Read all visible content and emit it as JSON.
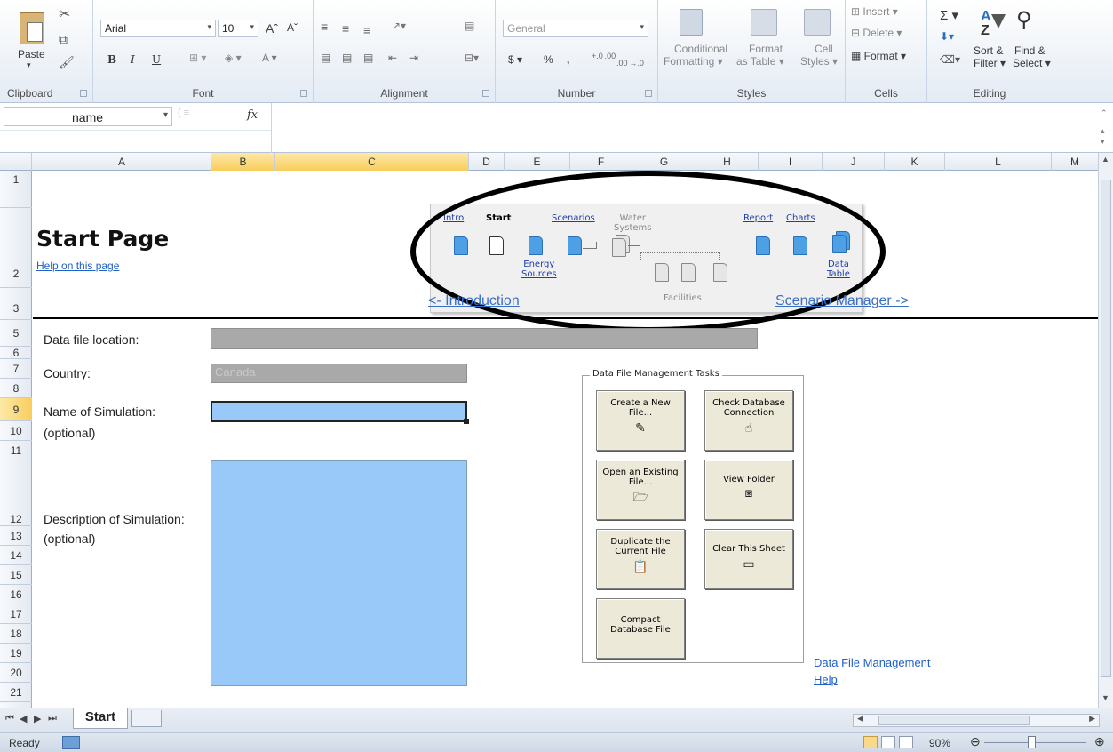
{
  "ribbon": {
    "clipboard": {
      "paste": "Paste",
      "label": "Clipboard"
    },
    "font": {
      "name": "Arial",
      "size": "10",
      "bold": "B",
      "italic": "I",
      "underline": "U",
      "grow": "Aˆ",
      "shrink": "Aˇ",
      "label": "Font"
    },
    "alignment": {
      "label": "Alignment"
    },
    "number": {
      "format": "General",
      "currency": "$",
      "percent": "%",
      "comma": ",",
      "inc_dec": "+.0 .00",
      "dec_dec": ".00 →.0",
      "label": "Number"
    },
    "styles": {
      "conditional": "Conditional",
      "conditional2": "Formatting",
      "format_table": "Format",
      "format_table2": "as Table",
      "cell_styles": "Cell",
      "cell_styles2": "Styles",
      "label": "Styles"
    },
    "cells": {
      "insert": "Insert",
      "delete": "Delete",
      "format": "Format",
      "label": "Cells"
    },
    "editing": {
      "sigma": "Σ",
      "sort": "Sort &",
      "sort2": "Filter",
      "find": "Find &",
      "find2": "Select",
      "label": "Editing"
    }
  },
  "formula_bar": {
    "name_box": "name",
    "fx": "fx",
    "value": ""
  },
  "columns": [
    "A",
    "B",
    "C",
    "D",
    "E",
    "F",
    "G",
    "H",
    "I",
    "J",
    "K",
    "L",
    "M"
  ],
  "rows": [
    "1",
    "2",
    "3",
    "5",
    "6",
    "7",
    "8",
    "9",
    "10",
    "11",
    "12",
    "13",
    "14",
    "15",
    "16",
    "17",
    "18",
    "19",
    "20",
    "21"
  ],
  "sheet": {
    "title": "Start Page",
    "help_link": "Help on this page",
    "prev_link": "<- Introduction",
    "next_link": "Scenario Manager ->",
    "data_file_label": "Data file location:",
    "data_file_value": "",
    "country_label": "Country:",
    "country_value": "Canada",
    "sim_name_label": "Name of Simulation:",
    "sim_name_optional": "(optional)",
    "sim_name_value": "",
    "desc_label": "Description of Simulation:",
    "desc_optional": "(optional)",
    "desc_value": "",
    "dfm_help_1": "Data File Management",
    "dfm_help_2": "Help"
  },
  "nav_diagram": {
    "intro": "Intro",
    "start": "Start",
    "scenarios": "Scenarios",
    "water_1": "Water",
    "water_2": "Systems",
    "report": "Report",
    "charts": "Charts",
    "energy_1": "Energy",
    "energy_2": "Sources",
    "data_1": "Data",
    "data_2": "Table",
    "facilities": "Facilities"
  },
  "tasks": {
    "legend": "Data File Management Tasks",
    "create_1": "Create a New",
    "create_2": "File...",
    "check_1": "Check Database",
    "check_2": "Connection",
    "open_1": "Open an Existing",
    "open_2": "File...",
    "view": "View Folder",
    "dup_1": "Duplicate the",
    "dup_2": "Current File",
    "clear": "Clear This Sheet",
    "compact_1": "Compact",
    "compact_2": "Database File"
  },
  "tabs": {
    "active": "Start"
  },
  "status": {
    "ready": "Ready",
    "zoom": "90%"
  },
  "colors": {
    "input_blue": "#99c9f8",
    "readonly_grey": "#a9a9a9",
    "nav_doc_blue": "#4d9fe6",
    "link_blue": "#1f5fc8",
    "selected_header": "#f8cd5d"
  }
}
